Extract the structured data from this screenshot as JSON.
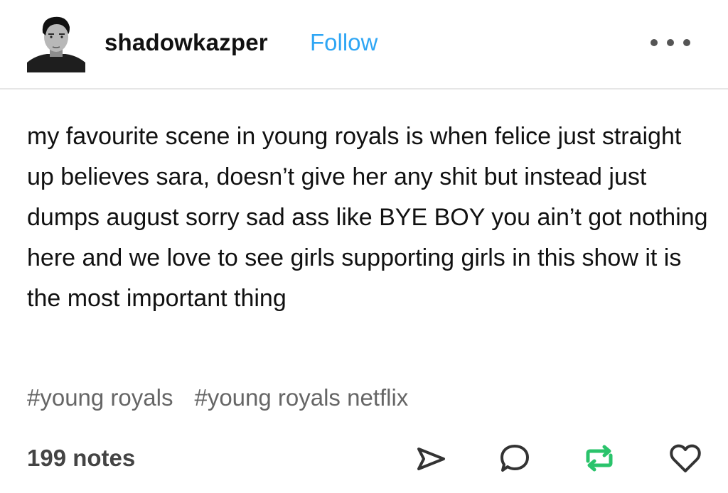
{
  "post": {
    "username": "shadowkazper",
    "follow_label": "Follow",
    "body": "my favourite scene in young royals is when felice just straight up believes sara, doesn’t give her any shit but instead just dumps august sorry sad ass like BYE BOY you ain’t got nothing here and we love to see girls supporting girls in this show it is the most important thing",
    "tags": [
      "#young royals",
      "#young royals netflix"
    ],
    "notes_label": "199 notes"
  },
  "icons": {
    "more": "more-dots-icon",
    "share": "send-icon",
    "reply": "comment-icon",
    "reblog": "reblog-icon",
    "like": "heart-icon"
  },
  "colors": {
    "follow": "#2fa6f4",
    "reblog": "#2ac36b",
    "icon": "#333333",
    "tag": "#666666"
  }
}
